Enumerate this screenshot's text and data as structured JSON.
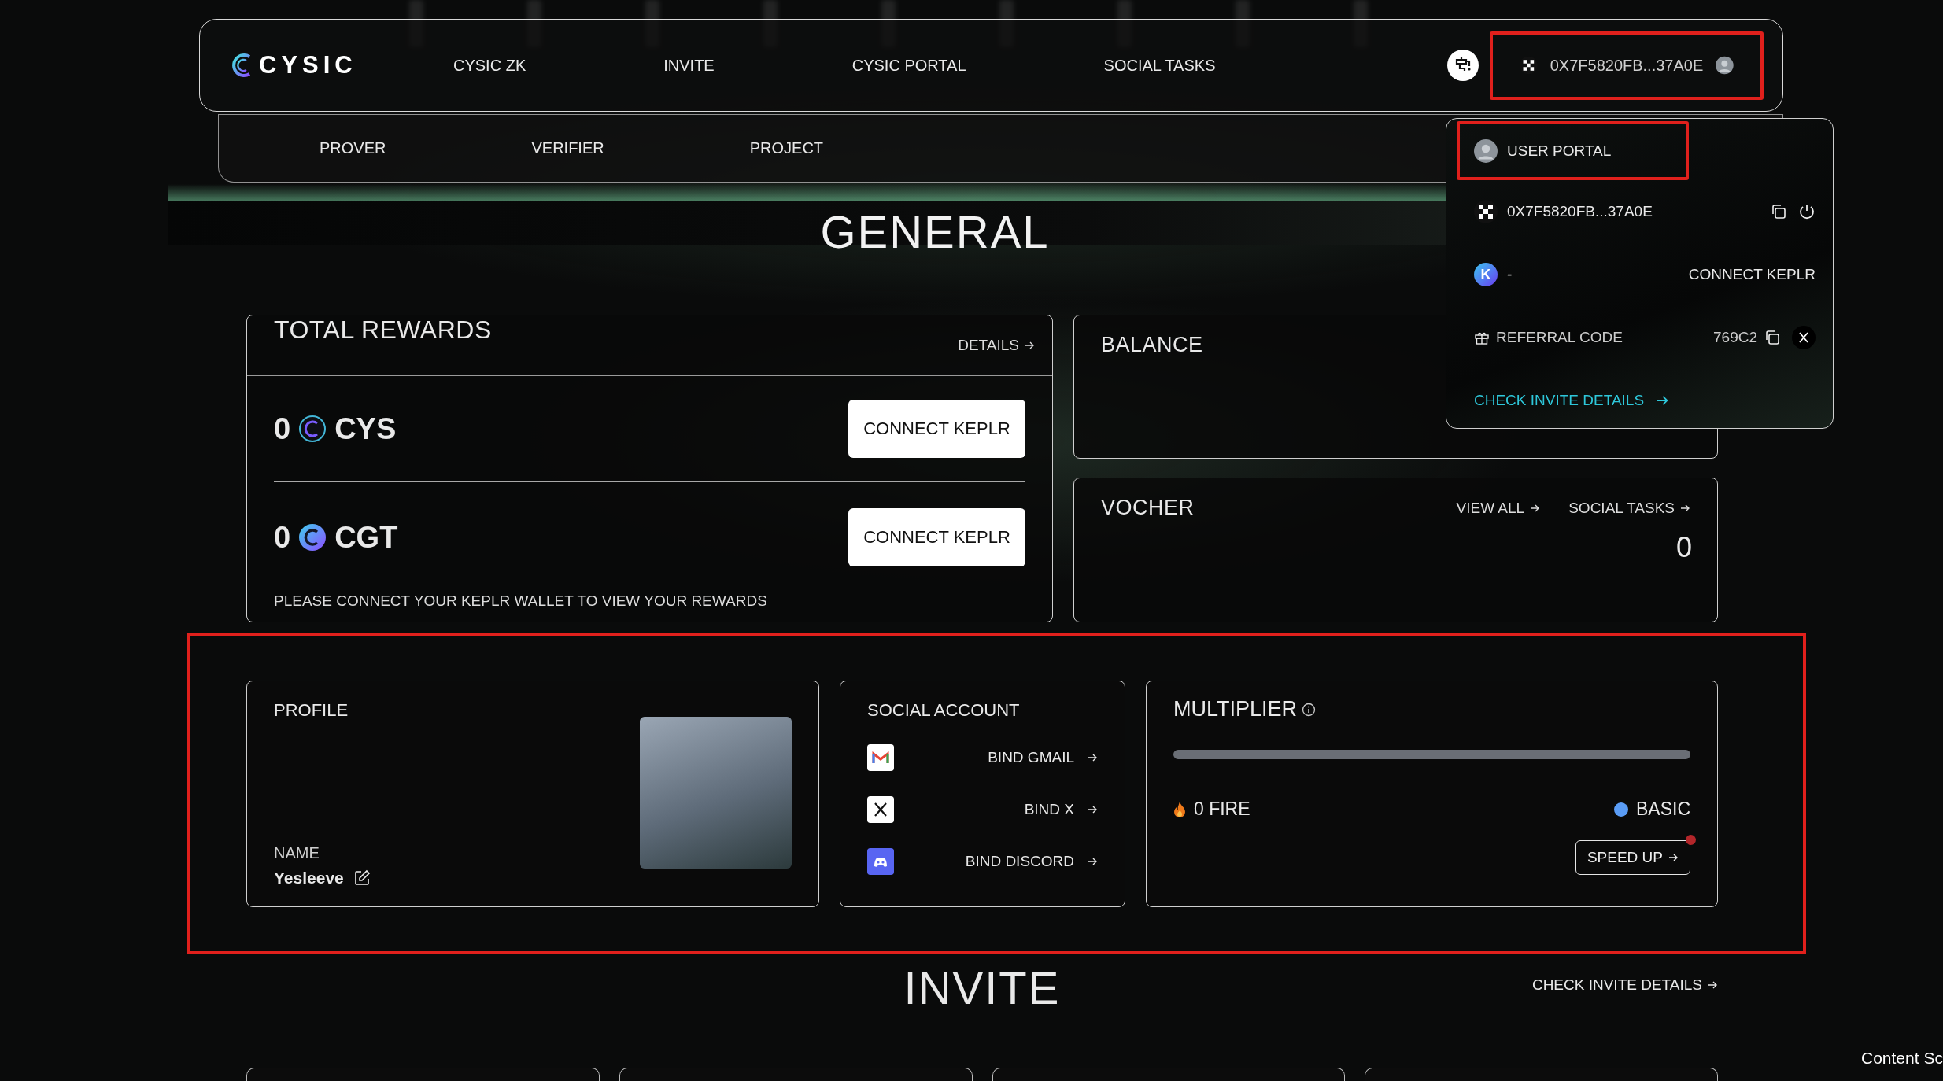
{
  "nav": {
    "logo": "CYSIC",
    "items": [
      {
        "label": "CYSIC ZK"
      },
      {
        "label": "INVITE"
      },
      {
        "label": "CYSIC PORTAL"
      },
      {
        "label": "SOCIAL TASKS"
      }
    ],
    "wallet": "0X7F5820FB...37A0E"
  },
  "subnav": {
    "items": [
      {
        "label": "PROVER"
      },
      {
        "label": "VERIFIER"
      },
      {
        "label": "PROJECT"
      }
    ]
  },
  "account_menu": {
    "portal": "USER PORTAL",
    "address": "0X7F5820FB...37A0E",
    "keplr_badge": "K",
    "keplr_value": "-",
    "keplr_action": "CONNECT KEPLR",
    "referral_label": "REFERRAL CODE",
    "referral_code": "769C2",
    "invite_link": "CHECK INVITE DETAILS"
  },
  "general": {
    "title": "GENERAL"
  },
  "total_rewards": {
    "title": "TOTAL REWARDS",
    "details": "DETAILS",
    "tokens": [
      {
        "amount": "0",
        "symbol": "CYS",
        "kind": "outline",
        "action": "CONNECT KEPLR"
      },
      {
        "amount": "0",
        "symbol": "CGT",
        "kind": "filled",
        "action": "CONNECT KEPLR"
      }
    ],
    "note": "PLEASE CONNECT YOUR KEPLR WALLET TO VIEW YOUR REWARDS"
  },
  "balance": {
    "title": "BALANCE"
  },
  "voucher": {
    "title": "VOCHER",
    "links": [
      "VIEW ALL",
      "SOCIAL TASKS"
    ],
    "count": "0"
  },
  "profile": {
    "title": "PROFILE",
    "name_label": "NAME",
    "name": "Yesleeve"
  },
  "social": {
    "title": "SOCIAL ACCOUNT",
    "accounts": [
      {
        "kind": "gmail",
        "label": "BIND GMAIL"
      },
      {
        "kind": "x",
        "label": "BIND X"
      },
      {
        "kind": "discord",
        "label": "BIND DISCORD"
      }
    ]
  },
  "multiplier": {
    "title": "MULTIPLIER",
    "level": 0,
    "fire": "0 FIRE",
    "tier": "BASIC",
    "speed_up": "SPEED UP",
    "speed_up_notice": true
  },
  "invite": {
    "title": "INVITE",
    "link": "CHECK INVITE DETAILS"
  },
  "corner_text": "Content Sc"
}
